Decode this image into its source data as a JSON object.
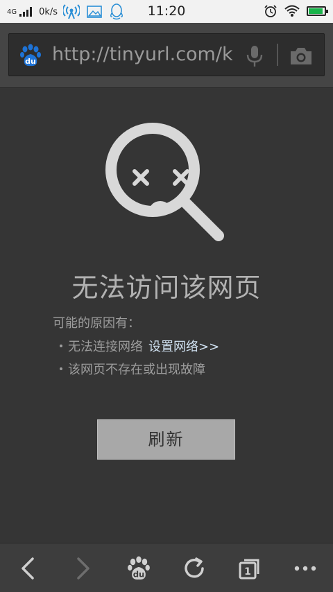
{
  "status_bar": {
    "network_type": "4G",
    "speed": "0k/s",
    "time": "11:20",
    "battery_level": 0.9,
    "battery_color": "#19b34a"
  },
  "address_bar": {
    "url": "http://tinyurl.com/k",
    "logo_text": "du"
  },
  "error": {
    "title": "无法访问该网页",
    "reasons_heading": "可能的原因有：",
    "reasons": [
      {
        "text": "无法连接网络",
        "link": "设置网络>>"
      },
      {
        "text": "该网页不存在或出现故障"
      }
    ],
    "refresh_label": "刷新"
  },
  "toolbar": {
    "tab_count": "1",
    "logo_text": "du"
  }
}
